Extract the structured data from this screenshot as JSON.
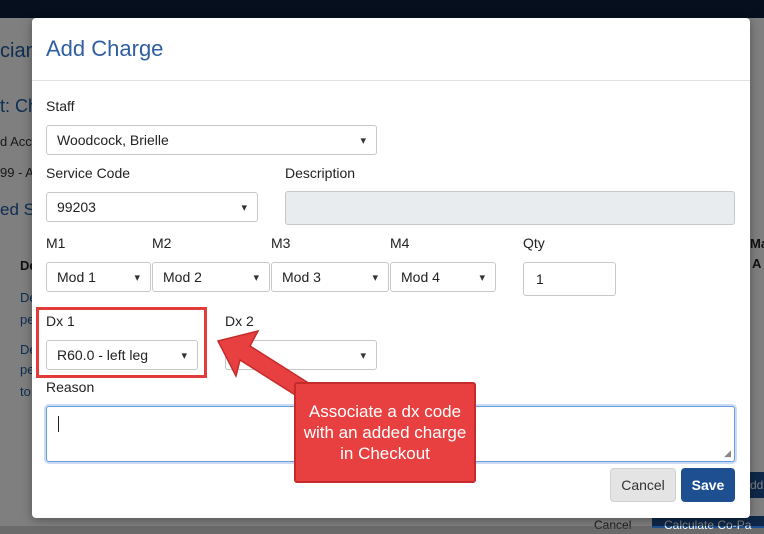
{
  "background": {
    "fragments": [
      "cian",
      "t: Ch",
      "d Acc",
      "99 - A",
      "ed Se",
      "De",
      "De",
      "pe",
      "De",
      "pe",
      "to",
      "Ma",
      "A",
      "Cancel",
      "Calculate Co-Pa",
      "dd"
    ]
  },
  "modal": {
    "title": "Add Charge",
    "staff": {
      "label": "Staff",
      "value": "Woodcock, Brielle"
    },
    "service_code": {
      "label": "Service Code",
      "value": "99203"
    },
    "description": {
      "label": "Description",
      "value": ""
    },
    "modifiers": [
      {
        "label": "M1",
        "value": "Mod 1"
      },
      {
        "label": "M2",
        "value": "Mod 2"
      },
      {
        "label": "M3",
        "value": "Mod 3"
      },
      {
        "label": "M4",
        "value": "Mod 4"
      }
    ],
    "qty": {
      "label": "Qty",
      "value": "1"
    },
    "dx1": {
      "label": "Dx 1",
      "value": "R60.0 - left leg"
    },
    "dx2": {
      "label": "Dx 2",
      "value": ""
    },
    "reason": {
      "label": "Reason",
      "value": ""
    },
    "buttons": {
      "cancel": "Cancel",
      "save": "Save"
    }
  },
  "annotation": {
    "callout_text": "Associate a dx code with an added charge in Checkout",
    "color": "#e84040"
  },
  "icons": {
    "dropdown": "chevron-down-icon",
    "resize": "resize-grip-icon"
  }
}
